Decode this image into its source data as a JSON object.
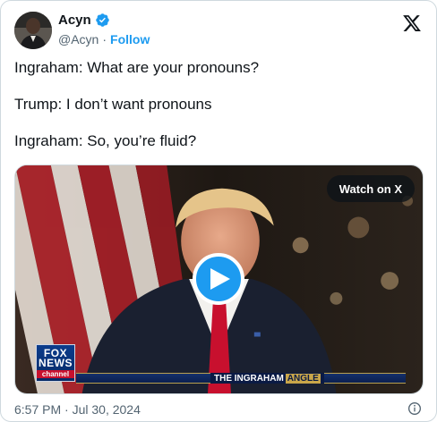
{
  "author": {
    "display_name": "Acyn",
    "handle": "@Acyn",
    "separator": "·",
    "follow_label": "Follow",
    "verified_color": "#1d9bf0"
  },
  "tweet": {
    "lines": [
      "Ingraham: What are your pronouns?",
      "Trump: I don’t want pronouns",
      "Ingraham: So, you’re fluid?"
    ]
  },
  "media": {
    "watch_label": "Watch on X",
    "play_icon": "play-icon",
    "network_logo": {
      "line1": "FOX",
      "line2": "NEWS",
      "line3": "channel"
    },
    "show_title": {
      "prefix": "THE INGRAHAM",
      "suffix": "ANGLE"
    }
  },
  "footer": {
    "timestamp": "6:57 PM · Jul 30, 2024",
    "info_icon": "info-icon"
  },
  "colors": {
    "accent": "#1d9bf0",
    "text_primary": "#0f1419",
    "text_secondary": "#536471",
    "border": "#cfd9de"
  }
}
